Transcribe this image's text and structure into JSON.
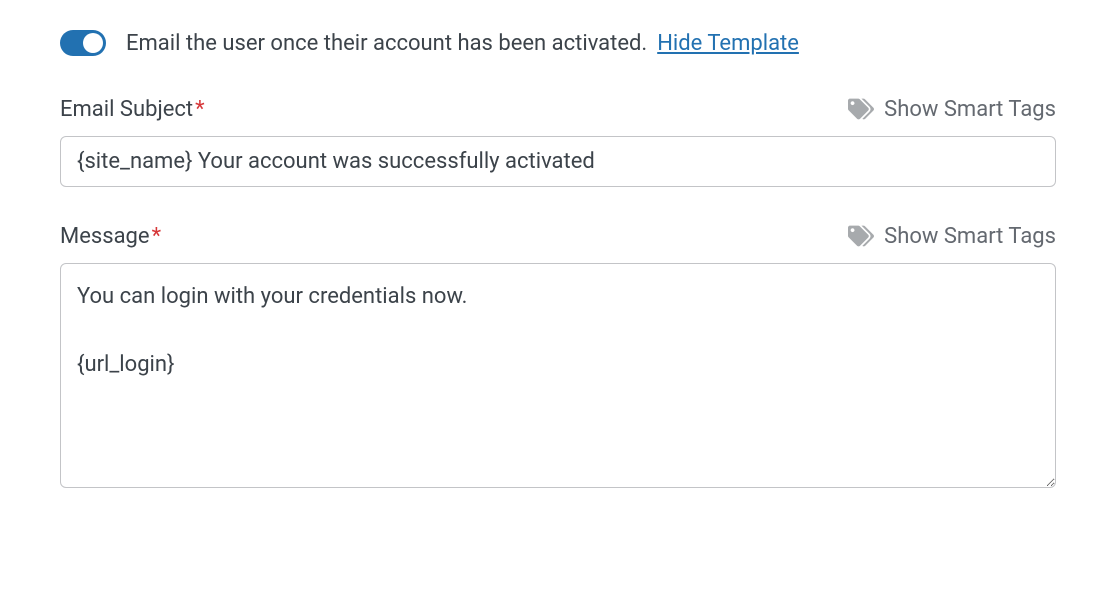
{
  "toggle": {
    "label": "Email the user once their account has been activated.",
    "hide_template": "Hide Template",
    "enabled": true
  },
  "subject": {
    "label": "Email Subject",
    "smart_tags_label": "Show Smart Tags",
    "value": "{site_name} Your account was successfully activated"
  },
  "message": {
    "label": "Message",
    "smart_tags_label": "Show Smart Tags",
    "value": "You can login with your credentials now.\n\n{url_login}"
  }
}
